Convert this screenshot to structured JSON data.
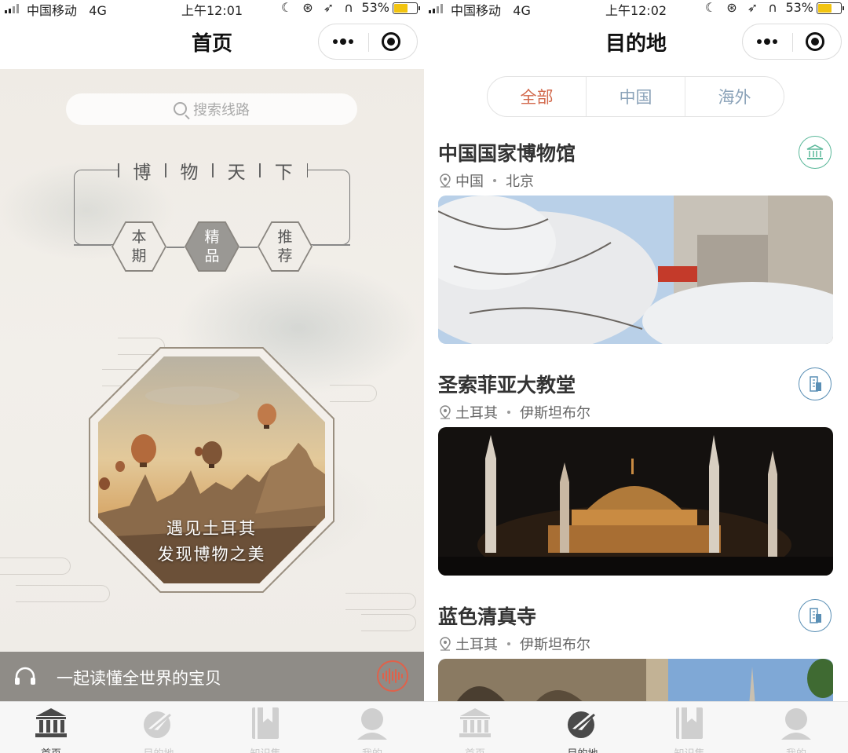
{
  "left": {
    "status": {
      "carrier": "中国移动",
      "network": "4G",
      "time": "上午12:01",
      "battery": "53%"
    },
    "nav_title": "首页",
    "search_placeholder": "搜索线路",
    "motto": [
      "博",
      "物",
      "天",
      "下"
    ],
    "hexes": [
      {
        "line1": "本",
        "line2": "期",
        "active": false
      },
      {
        "line1": "精",
        "line2": "品",
        "active": true
      },
      {
        "line1": "推",
        "line2": "荐",
        "active": false
      }
    ],
    "promo": {
      "line1": "遇见土耳其",
      "line2": "发现博物之美"
    },
    "audio_text": "一起读懂全世界的宝贝"
  },
  "right": {
    "status": {
      "carrier": "中国移动",
      "network": "4G",
      "time": "上午12:02",
      "battery": "53%"
    },
    "nav_title": "目的地",
    "segments": [
      {
        "label": "全部",
        "active": true
      },
      {
        "label": "中国",
        "active": false
      },
      {
        "label": "海外",
        "active": false
      }
    ],
    "cards": [
      {
        "title": "中国国家博物馆",
        "country": "中国",
        "city": "北京",
        "icon": "museum-icon",
        "icon_color": "#5bb89a"
      },
      {
        "title": "圣索菲亚大教堂",
        "country": "土耳其",
        "city": "伊斯坦布尔",
        "icon": "building-icon",
        "icon_color": "#5a8fb5"
      },
      {
        "title": "蓝色清真寺",
        "country": "土耳其",
        "city": "伊斯坦布尔",
        "icon": "building-icon",
        "icon_color": "#5a8fb5"
      }
    ]
  },
  "tabbar": {
    "tabs": [
      {
        "label": "首页",
        "icon": "museum-icon"
      },
      {
        "label": "目的地",
        "icon": "globe-plane-icon"
      },
      {
        "label": "知识集",
        "icon": "bookmark-book-icon"
      },
      {
        "label": "我的",
        "icon": "user-icon"
      }
    ],
    "left_active": 0,
    "right_active": 1
  },
  "colors": {
    "accent": "#d2694c",
    "segment_text": "#8aa2b8",
    "audio_bar": "#8f8c87"
  }
}
